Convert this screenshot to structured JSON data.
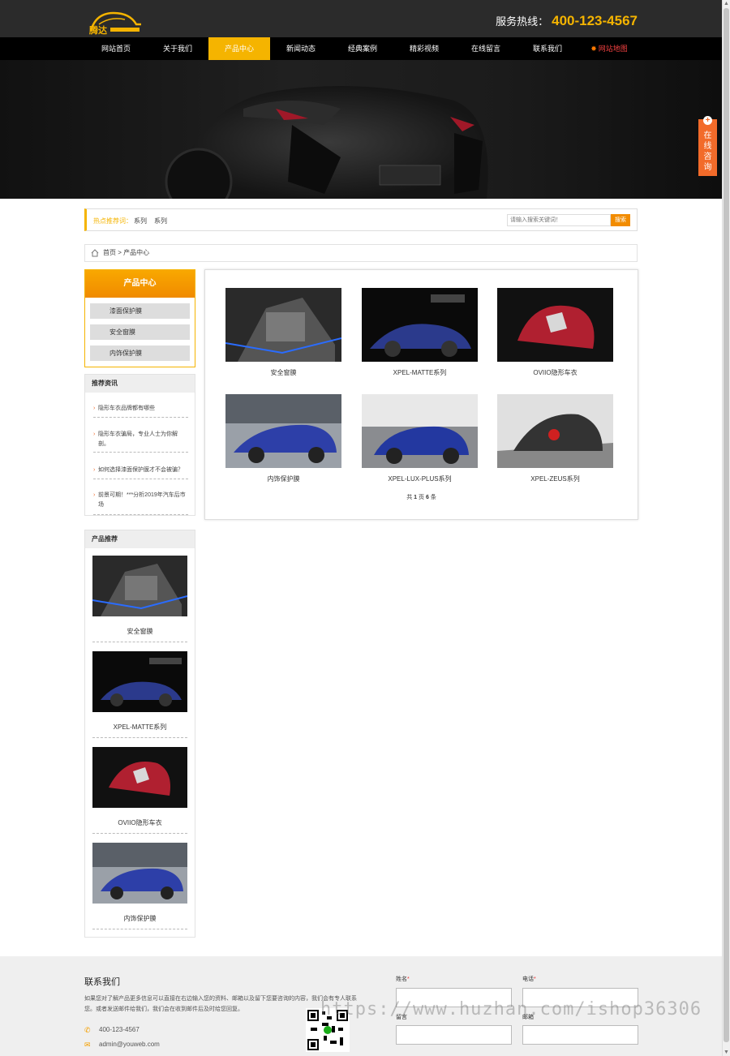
{
  "header": {
    "hotline_label": "服务热线：",
    "hotline_number": "400-123-4567"
  },
  "nav": {
    "items": [
      "网站首页",
      "关于我们",
      "产品中心",
      "新闻动态",
      "经典案例",
      "精彩视频",
      "在线留言",
      "联系我们",
      "网站地图"
    ],
    "active_index": 2
  },
  "consult": {
    "label_lines": [
      "在",
      "线",
      "咨",
      "询"
    ]
  },
  "hot_search": {
    "label": "热点推荐词：",
    "items": [
      "系列",
      "系列"
    ],
    "placeholder": "请输入搜索关键词！",
    "button": "搜索"
  },
  "breadcrumb": {
    "home": "首页",
    "separator": ">",
    "current": "产品中心"
  },
  "sidebar": {
    "category_title": "产品中心",
    "categories": [
      "漆面保护膜",
      "安全窗膜",
      "内饰保护膜"
    ],
    "news_title": "推荐资讯",
    "news": [
      "隐形车衣品牌都有哪些",
      "隐形车衣骗局，专业人士为你解剖。",
      "如何选择漆面保护膜才不会被骗？",
      "前景可期！***分析2019年汽车后市场"
    ],
    "products_title": "产品推荐",
    "products": [
      "安全窗膜",
      "XPEL-MATTE系列",
      "OVIIO隐形车衣",
      "内饰保护膜"
    ]
  },
  "products": [
    "安全窗膜",
    "XPEL-MATTE系列",
    "OVIIO隐形车衣",
    "内饰保护膜",
    "XPEL-LUX-PLUS系列",
    "XPEL-ZEUS系列"
  ],
  "pager": {
    "prefix": "共",
    "pages": "1",
    "mid": "页",
    "count": "6",
    "suffix": "条"
  },
  "footer": {
    "title": "联系我们",
    "description": "如果您对了解产品更多信息可以直接在右边输入您的资料、邮箱以及留下您要咨询的内容，我们会有专人联系您。或者发送邮件给我们，我们会在收到邮件后及时给您回复。",
    "phone": "400-123-4567",
    "email": "admin@youweb.com",
    "form": {
      "name": "姓名",
      "tel": "电话",
      "email": "邮箱",
      "note": "留言"
    }
  },
  "watermark": "https://www.huzhan.com/ishop36306",
  "colors": {
    "accent": "#f5b400",
    "orange": "#f26b2a",
    "nav_bg": "#000000"
  }
}
